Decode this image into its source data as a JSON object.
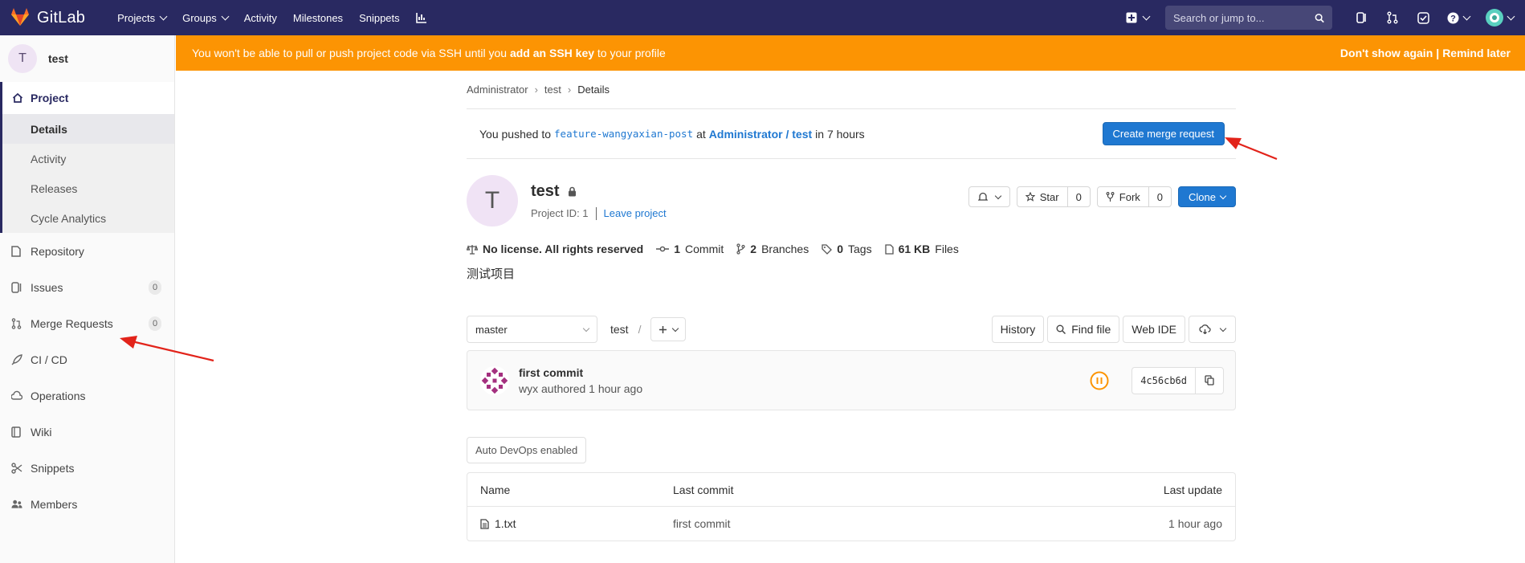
{
  "nav": {
    "brand": "GitLab",
    "links": [
      {
        "label": "Projects",
        "dropdown": true
      },
      {
        "label": "Groups",
        "dropdown": true
      },
      {
        "label": "Activity",
        "dropdown": false
      },
      {
        "label": "Milestones",
        "dropdown": false
      },
      {
        "label": "Snippets",
        "dropdown": false
      }
    ],
    "search_placeholder": "Search or jump to...",
    "colors": {
      "bg": "#292961",
      "accent": "#fc6d26"
    }
  },
  "sidebar": {
    "project_initial": "T",
    "project_name": "test",
    "section": "Project",
    "sub_items": [
      "Details",
      "Activity",
      "Releases",
      "Cycle Analytics"
    ],
    "active_sub": "Details",
    "items": [
      {
        "label": "Repository",
        "icon": "doc-icon",
        "badge": ""
      },
      {
        "label": "Issues",
        "icon": "issues-icon",
        "badge": "0"
      },
      {
        "label": "Merge Requests",
        "icon": "merge-request-icon",
        "badge": "0"
      },
      {
        "label": "CI / CD",
        "icon": "rocket-icon",
        "badge": ""
      },
      {
        "label": "Operations",
        "icon": "cloud-gear-icon",
        "badge": ""
      },
      {
        "label": "Wiki",
        "icon": "book-icon",
        "badge": ""
      },
      {
        "label": "Snippets",
        "icon": "scissors-icon",
        "badge": ""
      },
      {
        "label": "Members",
        "icon": "users-icon",
        "badge": ""
      }
    ]
  },
  "banner": {
    "prefix": "You won't be able to pull or push project code via SSH until you",
    "link": "add an SSH key",
    "suffix": "to your profile",
    "dismiss": "Don't show again",
    "separator": "|",
    "remind": "Remind later",
    "color": "#fc9403"
  },
  "breadcrumb": [
    "Administrator",
    "test",
    "Details"
  ],
  "push": {
    "prefix": "You pushed to",
    "branch": "feature-wangyaxian-post",
    "at": "at",
    "path": "Administrator / test",
    "time": "in 7 hours",
    "button": "Create merge request"
  },
  "project": {
    "initial": "T",
    "name": "test",
    "id_label": "Project ID: 1",
    "leave": "Leave project",
    "star_label": "Star",
    "star_count": "0",
    "fork_label": "Fork",
    "fork_count": "0",
    "clone_label": "Clone"
  },
  "stats": {
    "license": "No license. All rights reserved",
    "commits_num": "1",
    "commits_label": "Commit",
    "branches_num": "2",
    "branches_label": "Branches",
    "tags_num": "0",
    "tags_label": "Tags",
    "size_num": "61 KB",
    "size_label": "Files"
  },
  "description": "测试项目",
  "tree": {
    "branch": "master",
    "path": "test",
    "slash": "/",
    "history": "History",
    "find_file": "Find file",
    "web_ide": "Web IDE"
  },
  "commit": {
    "title": "first commit",
    "author_line": "wyx authored 1 hour ago",
    "sha": "4c56cb6d",
    "status_color": "#fc9403"
  },
  "devops": "Auto DevOps enabled",
  "files": {
    "headers": [
      "Name",
      "Last commit",
      "Last update"
    ],
    "rows": [
      {
        "name": "1.txt",
        "last_commit": "first commit",
        "last_update": "1 hour ago"
      }
    ]
  }
}
